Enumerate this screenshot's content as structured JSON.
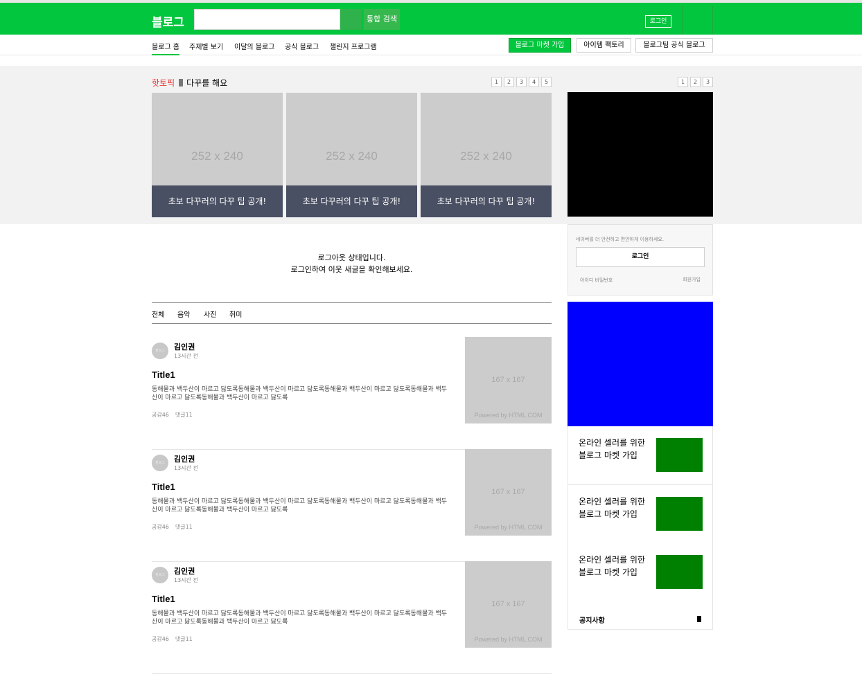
{
  "header": {
    "logo": "블로그",
    "search_placeholder": "",
    "total_search_label": "통합 검색",
    "login_label": "로그인"
  },
  "nav": {
    "items": [
      "블로그 홈",
      "주제별 보기",
      "이달의 블로그",
      "공식 블로그",
      "챌린지 프로그램"
    ],
    "buttons": [
      "블로그 마켓 가입",
      "아이템 팩토리",
      "블로그팀 공식 블로그"
    ]
  },
  "hot": {
    "label_red": "핫토픽",
    "label_text": "다꾸를 해요",
    "pages": [
      "1",
      "2",
      "3",
      "4",
      "5"
    ],
    "cards": [
      {
        "placeholder": "252 x 240",
        "caption": "초보 다꾸러의 다꾸 팁 공개!"
      },
      {
        "placeholder": "252 x 240",
        "caption": "초보 다꾸러의 다꾸 팁 공개!"
      },
      {
        "placeholder": "252 x 240",
        "caption": "초보 다꾸러의 다꾸 팁 공개!"
      }
    ]
  },
  "side_pager": [
    "1",
    "2",
    "3"
  ],
  "logout": {
    "line1": "로그아웃 상태입니다.",
    "line2": "로그인하여 이웃 새글을 확인해보세요."
  },
  "filters": [
    "전체",
    "음악",
    "사진",
    "취미"
  ],
  "posts": [
    {
      "avatar": "블로그",
      "author": "김인권",
      "time": "13시간 전",
      "title": "Title1",
      "body": "동해물과 백두산이 마르고 닳도록동해물과 백두산이 마르고 닳도록동해물과 백두산이 마르고 닳도록동해물과 백두산이 마르고 닳도록동해물과 백두산이 마르고 닳도록",
      "likes": "공감46",
      "comments": "댓글11",
      "thumb": "167 x 167",
      "powered": "Powered by HTML.COM"
    },
    {
      "avatar": "블로그",
      "author": "김인권",
      "time": "13시간 전",
      "title": "Title1",
      "body": "동해물과 백두산이 마르고 닳도록동해물과 백두산이 마르고 닳도록동해물과 백두산이 마르고 닳도록동해물과 백두산이 마르고 닳도록동해물과 백두산이 마르고 닳도록",
      "likes": "공감46",
      "comments": "댓글11",
      "thumb": "167 x 167",
      "powered": "Powered by HTML.COM"
    },
    {
      "avatar": "블로그",
      "author": "김인권",
      "time": "13시간 전",
      "title": "Title1",
      "body": "동해물과 백두산이 마르고 닳도록동해물과 백두산이 마르고 닳도록동해물과 백두산이 마르고 닳도록동해물과 백두산이 마르고 닳도록동해물과 백두산이 마르고 닳도록",
      "likes": "공감46",
      "comments": "댓글11",
      "thumb": "167 x 167",
      "powered": "Powered by HTML.COM"
    }
  ],
  "login_panel": {
    "hint": "네이버를 더 안전하고 편안하게 이용하세요.",
    "button": "로그인",
    "find": "아이디 비밀번호",
    "join": "회원가입"
  },
  "promos": [
    {
      "text": "온라인 셀러를 위한\n블로그 마켓 가입"
    },
    {
      "text": "온라인 셀러를 위한\n블로그 마켓 가입"
    },
    {
      "text": "온라인 셀러를 위한\n블로그 마켓 가입"
    }
  ],
  "notice": {
    "title": "공지사항"
  },
  "colors": {
    "brand_green": "#03c63f",
    "caption_bg": "#4a5063",
    "promo_green": "#008000",
    "ad_blue": "#0000ff",
    "hot_red": "#e53935"
  }
}
